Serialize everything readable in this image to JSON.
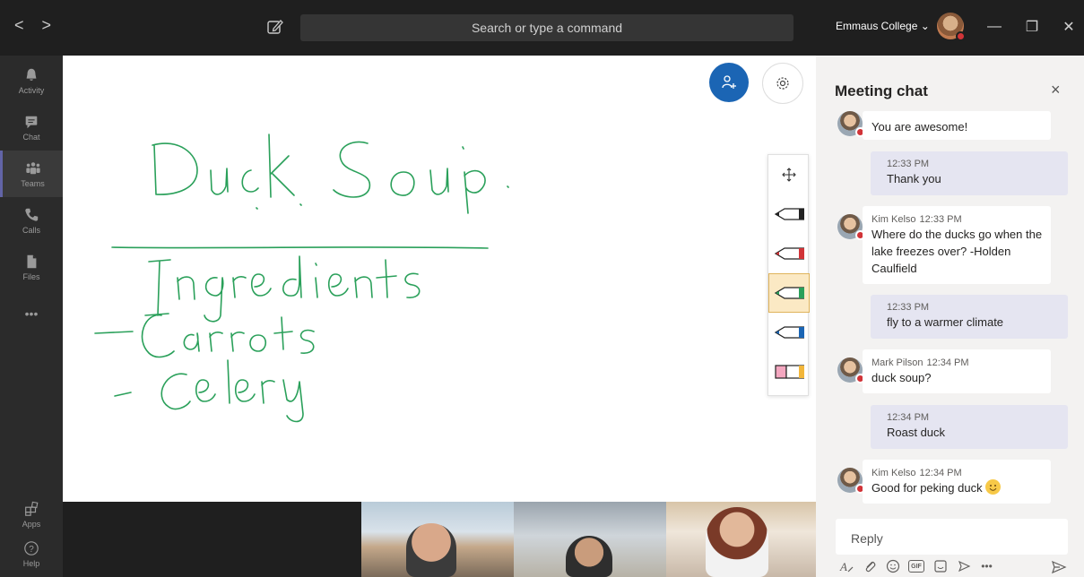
{
  "titlebar": {
    "search_placeholder": "Search or type a command",
    "org_name": "Emmaus College ⌄",
    "back": "<",
    "forward": ">",
    "minimize": "—",
    "restore": "❐",
    "close": "✕"
  },
  "rail": {
    "items": [
      {
        "label": "Activity",
        "icon": "bell-icon"
      },
      {
        "label": "Chat",
        "icon": "chat-icon"
      },
      {
        "label": "Teams",
        "icon": "teams-icon",
        "active": true
      },
      {
        "label": "Calls",
        "icon": "phone-icon"
      },
      {
        "label": "Files",
        "icon": "file-icon"
      },
      {
        "label": "•••",
        "icon": "more-icon"
      }
    ],
    "bottom": [
      {
        "label": "Apps",
        "icon": "apps-icon"
      },
      {
        "label": "Help",
        "icon": "help-icon"
      }
    ]
  },
  "whiteboard": {
    "ink_color": "#2aa05a",
    "tools": [
      "move-tool",
      "black-pen",
      "red-pen",
      "green-pen",
      "blue-pen",
      "eraser"
    ],
    "selected_tool": "green-pen"
  },
  "chat": {
    "title": "Meeting chat",
    "close": "×",
    "messages": [
      {
        "from": "",
        "time": "",
        "text": "You are awesome!",
        "self": false
      },
      {
        "from": "",
        "time": "12:33 PM",
        "text": "Thank you",
        "self": true
      },
      {
        "from": "Kim Kelso",
        "time": "12:33 PM",
        "text": "Where do the ducks go when the lake freezes over? -Holden Caulfield",
        "self": false
      },
      {
        "from": "",
        "time": "12:33 PM",
        "text": "fly to a warmer climate",
        "self": true
      },
      {
        "from": "Mark Pilson",
        "time": "12:34 PM",
        "text": "duck soup?",
        "self": false
      },
      {
        "from": "",
        "time": "12:34 PM",
        "text": "Roast duck",
        "self": true
      },
      {
        "from": "Kim Kelso",
        "time": "12:34 PM",
        "text": "Good for peking duck",
        "self": false
      }
    ],
    "reply_placeholder": "Reply",
    "compose_tools": [
      "format-icon",
      "attach-icon",
      "emoji-icon",
      "gif-icon",
      "sticker-icon",
      "meet-icon",
      "more-icon"
    ],
    "gif_label": "GIF",
    "more_label": "•••"
  },
  "colors": {
    "accent": "#6264a7",
    "invite_button": "#1b65b4",
    "presence_busy": "#d13438"
  }
}
